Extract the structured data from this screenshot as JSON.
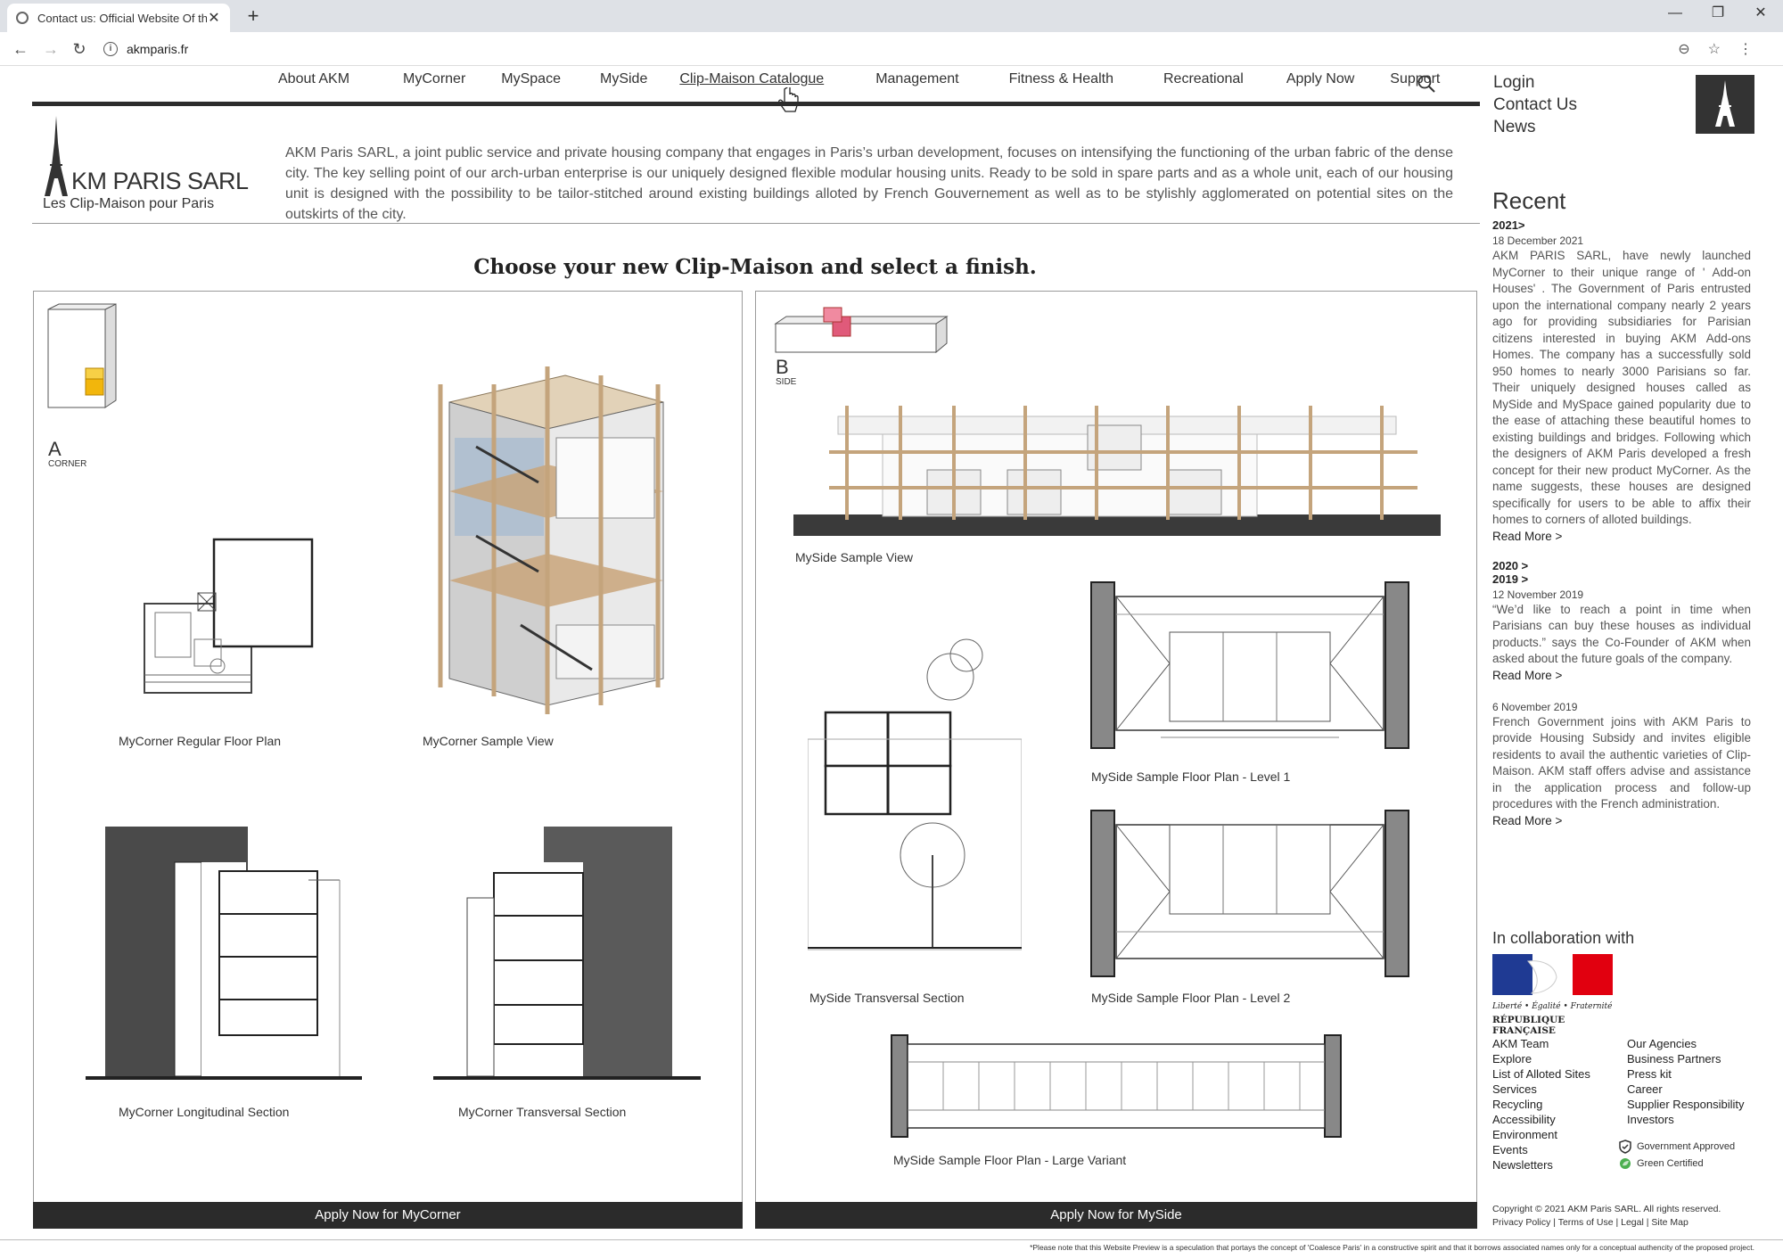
{
  "browser": {
    "tab_title": "Contact us: Official Website Of the",
    "url": "akmparis.fr"
  },
  "nav": {
    "items": [
      "About AKM",
      "MyCorner",
      "MySpace",
      "MySide",
      "Clip-Maison Catalogue",
      "Management",
      "Fitness & Health",
      "Recreational",
      "Apply Now",
      "Support"
    ],
    "side_links": [
      "Login",
      "Contact Us",
      "News"
    ]
  },
  "brand": {
    "name": "KM PARIS SARL",
    "initial": "A",
    "tagline": "Les Clip-Maison pour Paris"
  },
  "intro": "AKM Paris SARL, a joint public service and private housing company that engages in Paris’s urban development, focuses on intensifying the functioning of the urban fabric of the dense city. The key selling point of our arch-urban enterprise is our uniquely designed flexible modular housing units. Ready to be sold in spare parts and as a whole unit, each of our housing unit is designed with the possibility to be tailor-stitched around existing buildings alloted by French Gouvernement as well as to be stylishly agglomerated on potential sites on the outskirts of the city.",
  "heading": "Choose your new Clip-Maison and select a finish.",
  "panel_a": {
    "letter": "A",
    "type": "CORNER",
    "captions": [
      "MyCorner Regular Floor Plan",
      "MyCorner Sample View",
      "MyCorner Longitudinal Section",
      "MyCorner Transversal Section"
    ],
    "apply": "Apply Now for MyCorner"
  },
  "panel_b": {
    "letter": "B",
    "type": "SIDE",
    "captions": [
      "MySide Sample View",
      "MySide Sample Floor Plan - Level 1",
      "MySide Transversal Section",
      "MySide Sample Floor Plan - Level 2",
      "MySide Sample Floor Plan - Large Variant"
    ],
    "apply": "Apply Now for MySide"
  },
  "sidebar": {
    "heading": "Recent",
    "year_2021": "2021>",
    "news1": {
      "date": "18 December 2021",
      "body": "AKM PARIS SARL, have newly launched MyCorner to their unique range of ' Add-on Houses' . The Government of Paris entrusted upon the international company nearly 2 years ago for providing subsidiaries for Parisian citizens interested in buying AKM Add-ons Homes. The company has a successfully sold 950 homes to nearly 3000 Parisians so far. Their uniquely designed houses called as MySide and MySpace gained popularity due to the ease of attaching these beautiful homes to existing buildings and bridges. Following which the designers of AKM Paris developed a fresh concept for their new product MyCorner. As the name suggests, these houses are designed specifically for users to be able to affix their homes to corners of alloted buildings.",
      "read_more": "Read More >"
    },
    "year_2020": "2020 >",
    "year_2019": "2019 >",
    "news2": {
      "date": "12 November 2019",
      "body": "“We’d like to reach a point in time when Parisians can buy these houses as individual products.” says the Co-Founder of AKM when asked about the future goals of the company.",
      "read_more": "Read More >"
    },
    "news3": {
      "date": "6 November 2019",
      "body": "French Government joins with AKM Paris to provide Housing Subsidy and invites eligible residents to avail the authentic varieties of Clip-Maison. AKM staff offers advise and assistance in the application process and follow-up procedures with the French administration.",
      "read_more": "Read More >"
    }
  },
  "collab": {
    "label": "In collaboration with",
    "motto": "Liberté • Égalité • Fraternité",
    "republique": "RÉPUBLIQUE FRANÇAISE"
  },
  "footer": {
    "col1": [
      "AKM Team",
      "Explore",
      "List of Alloted Sites",
      "Services",
      "Recycling",
      "Accessibility",
      "Environment",
      "Events",
      "Newsletters"
    ],
    "col2": [
      "Our Agencies",
      "Business Partners",
      "Press kit",
      "Career",
      "Supplier Responsibility",
      "Investors"
    ],
    "badge_gov": "Government Approved",
    "badge_green": "Green Certified",
    "copyright": "Copyright © 2021 AKM Paris SARL. All rights reserved.",
    "legal_links": "Privacy Policy  |  Terms of Use |  Legal |  Site Map",
    "disclaimer": "*Please note that this Website Preview is a speculation that portays the concept of 'Coalesce Paris' in a constructive spirit and that it borrows associated names only for a conceptual authencity of the proposed project."
  }
}
